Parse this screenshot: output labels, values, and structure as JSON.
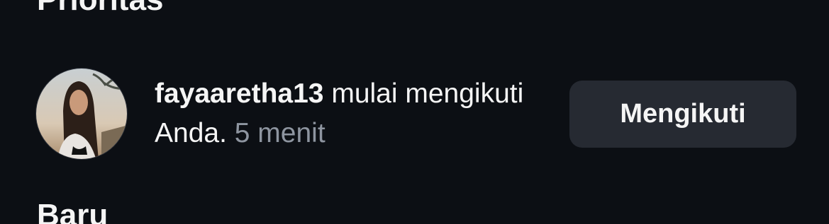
{
  "sections": {
    "priority_title": "Prioritas",
    "new_title": "Baru"
  },
  "notification": {
    "username": "fayaaretha13",
    "message": "mulai mengikuti Anda.",
    "time": "5 menit",
    "follow_button_label": "Mengikuti"
  }
}
